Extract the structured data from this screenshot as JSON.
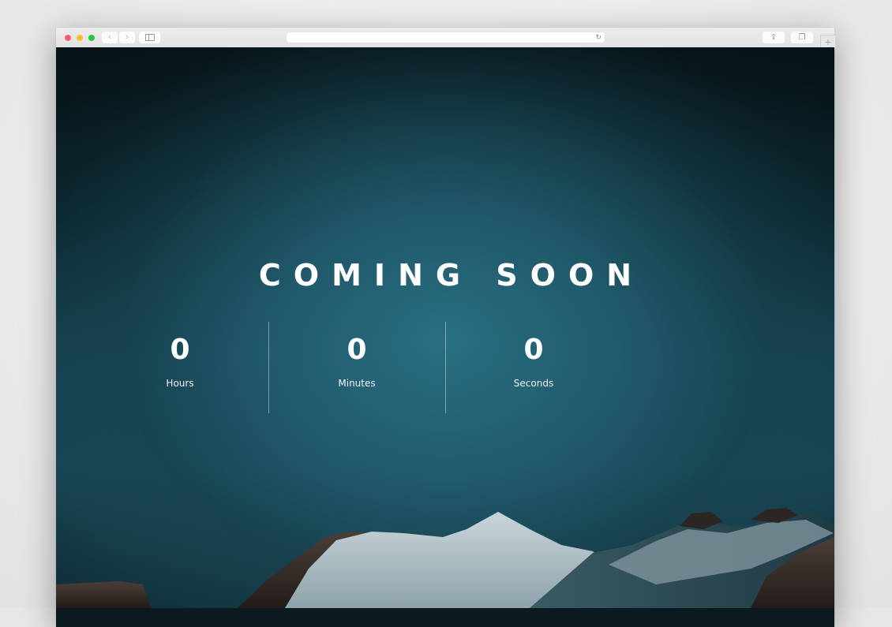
{
  "browser": {
    "address_value": "",
    "back_icon": "chevron-left-icon",
    "forward_icon": "chevron-right-icon",
    "sidebar_icon": "sidebar-icon",
    "reload_icon": "reload-icon",
    "share_icon": "share-icon",
    "tabs_icon": "tabs-overview-icon",
    "new_tab_icon": "plus-icon",
    "glyphs": {
      "back": "‹",
      "forward": "›",
      "reload": "↻",
      "share": "⇪",
      "tabs": "❐",
      "new_tab": "+"
    }
  },
  "page": {
    "headline": "COMING SOON",
    "countdown": [
      {
        "value": "0",
        "label": "Hours"
      },
      {
        "value": "0",
        "label": "Minutes"
      },
      {
        "value": "0",
        "label": "Seconds"
      }
    ],
    "colors": {
      "text": "#ffffff",
      "background_center": "#2a7084",
      "background_top": "#0a191d",
      "divider": "#c8dce2"
    }
  }
}
